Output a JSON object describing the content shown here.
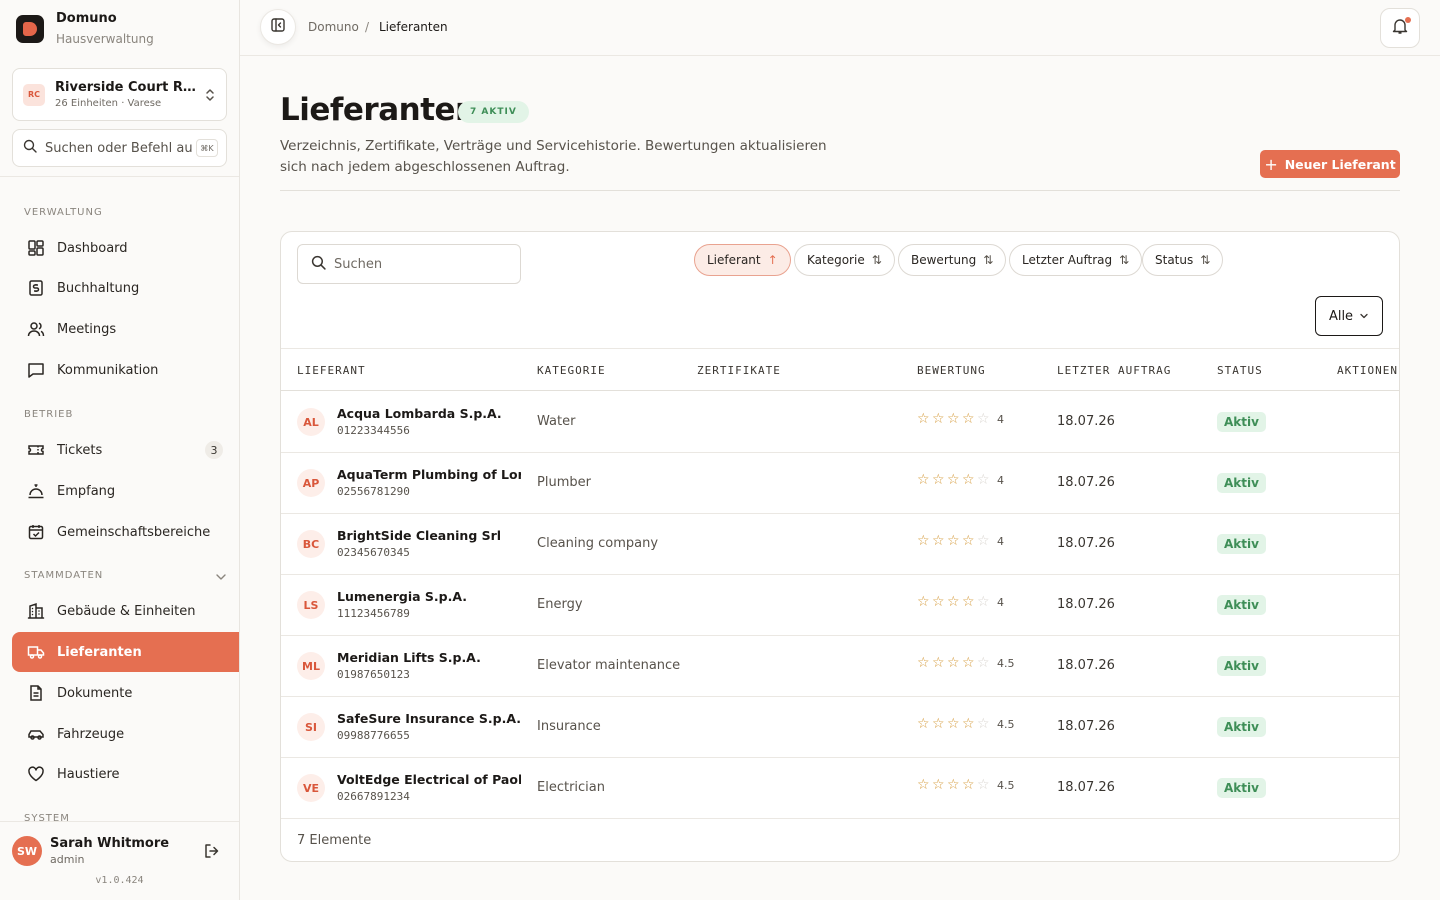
{
  "brand": {
    "name": "Domuno",
    "subtitle": "Hausverwaltung"
  },
  "property": {
    "initials": "RC",
    "name": "Riverside Court Residences",
    "meta": "26 Einheiten · Varese"
  },
  "sidebar_search": {
    "placeholder": "Suchen oder Befehl ausführen",
    "shortcut": "⌘K"
  },
  "sections": {
    "verwaltung": "VERWALTUNG",
    "betrieb": "BETRIEB",
    "stammdaten": "STAMMDATEN",
    "system": "SYSTEM"
  },
  "nav": {
    "dashboard": "Dashboard",
    "buchhaltung": "Buchhaltung",
    "meetings": "Meetings",
    "kommunikation": "Kommunikation",
    "tickets": "Tickets",
    "tickets_badge": "3",
    "empfang": "Empfang",
    "gemeinschaft": "Gemeinschaftsbereiche",
    "gebaeude": "Gebäude & Einheiten",
    "lieferanten": "Lieferanten",
    "dokumente": "Dokumente",
    "fahrzeuge": "Fahrzeuge",
    "haustiere": "Haustiere"
  },
  "user": {
    "initials": "SW",
    "name": "Sarah Whitmore",
    "role": "admin",
    "version": "v1.0.424"
  },
  "breadcrumb": {
    "root": "Domuno",
    "sep": "/",
    "current": "Lieferanten"
  },
  "page": {
    "title": "Lieferanten",
    "count_badge": "7 AKTIV",
    "description": "Verzeichnis, Zertifikate, Verträge und Servicehistorie. Bewertungen aktualisieren sich nach jedem abgeschlossenen Auftrag.",
    "new_button": "Neuer Lieferant"
  },
  "table_search": {
    "placeholder": "Suchen"
  },
  "sort_chips": {
    "lieferant": "Lieferant",
    "kategorie": "Kategorie",
    "bewertung": "Bewertung",
    "letzter_auftrag": "Letzter Auftrag",
    "status": "Status"
  },
  "filter": {
    "value": "Alle"
  },
  "columns": {
    "lieferant": "LIEFERANT",
    "kategorie": "KATEGORIE",
    "zertifikate": "ZERTIFIKATE",
    "bewertung": "BEWERTUNG",
    "letzter_auftrag": "LETZTER AUFTRAG",
    "status": "STATUS",
    "aktionen": "AKTIONEN"
  },
  "vendors": [
    {
      "initials": "AL",
      "name": "Acqua Lombarda S.p.A.",
      "id": "01223344556",
      "category": "Water",
      "rating": 4,
      "rating_label": "4",
      "last_order": "18.07.26",
      "status": "Aktiv"
    },
    {
      "initials": "AP",
      "name": "AquaTerm Plumbing of Lorenzo",
      "id": "02556781290",
      "category": "Plumber",
      "rating": 4,
      "rating_label": "4",
      "last_order": "18.07.26",
      "status": "Aktiv"
    },
    {
      "initials": "BC",
      "name": "BrightSide Cleaning Srl",
      "id": "02345670345",
      "category": "Cleaning company",
      "rating": 4,
      "rating_label": "4",
      "last_order": "18.07.26",
      "status": "Aktiv"
    },
    {
      "initials": "LS",
      "name": "Lumenergia S.p.A.",
      "id": "11123456789",
      "category": "Energy",
      "rating": 4,
      "rating_label": "4",
      "last_order": "18.07.26",
      "status": "Aktiv"
    },
    {
      "initials": "ML",
      "name": "Meridian Lifts S.p.A.",
      "id": "01987650123",
      "category": "Elevator maintenance",
      "rating": 4.5,
      "rating_label": "4.5",
      "last_order": "18.07.26",
      "status": "Aktiv"
    },
    {
      "initials": "SI",
      "name": "SafeSure Insurance S.p.A.",
      "id": "09988776655",
      "category": "Insurance",
      "rating": 4.5,
      "rating_label": "4.5",
      "last_order": "18.07.26",
      "status": "Aktiv"
    },
    {
      "initials": "VE",
      "name": "VoltEdge Electrical of Paolo Gra",
      "id": "02667891234",
      "category": "Electrician",
      "rating": 4.5,
      "rating_label": "4.5",
      "last_order": "18.07.26",
      "status": "Aktiv"
    }
  ],
  "footer": {
    "count_label": "7 Elemente"
  },
  "colors": {
    "accent": "#e56f51",
    "success_bg": "#e2f4e7",
    "success_text": "#3e8e57",
    "star": "#d59a3a"
  }
}
